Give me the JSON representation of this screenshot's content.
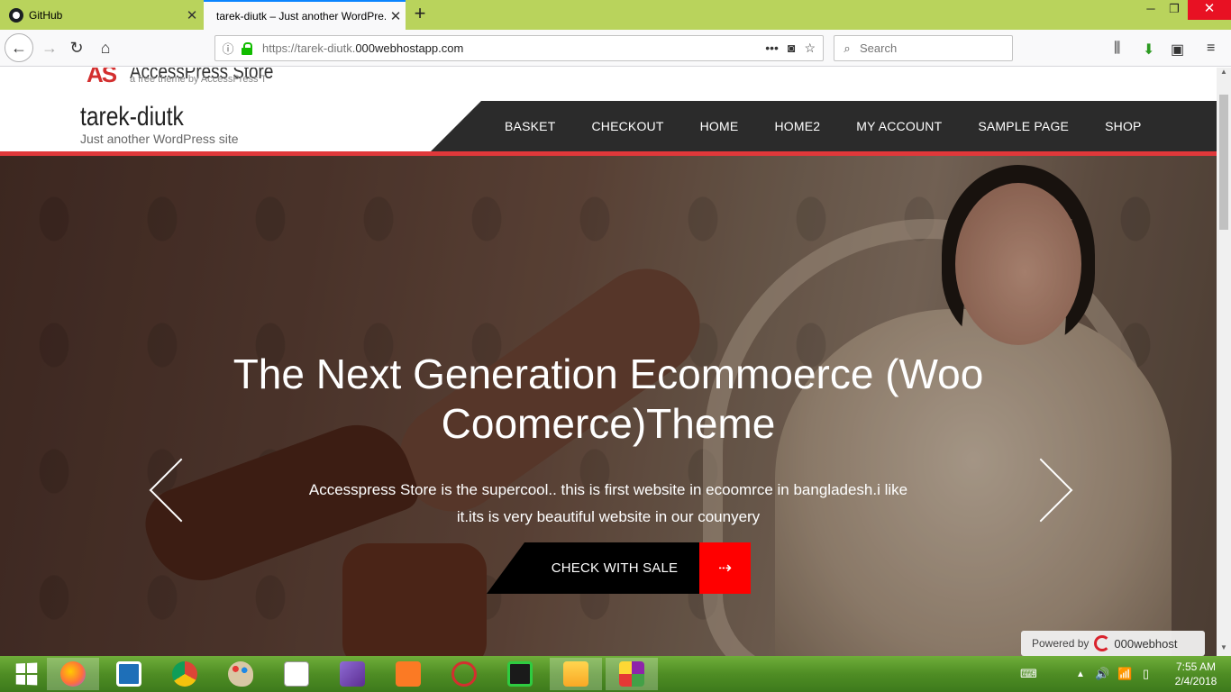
{
  "browser": {
    "tabs": [
      {
        "title": "GitHub",
        "icon": "github-icon"
      },
      {
        "title": "tarek-diutk – Just another WordPre..",
        "icon": "none"
      }
    ],
    "new_tab": "+",
    "window_controls": {
      "minimize": "─",
      "restore": "❐",
      "close": "✕"
    }
  },
  "navbar": {
    "url_scheme": "https://tarek-diutk.",
    "url_domain": "000webhostapp.com",
    "page_actions": "•••",
    "search_placeholder": "Search"
  },
  "site": {
    "logo_mark": "AS",
    "logo_name": "AccessPress Store",
    "logo_tagline": "a free theme by AccessPress T",
    "title": "tarek-diutk",
    "description": "Just another WordPress site",
    "menu": [
      "BASKET",
      "CHECKOUT",
      "HOME",
      "HOME2",
      "MY ACCOUNT",
      "SAMPLE PAGE",
      "SHOP"
    ]
  },
  "hero": {
    "title": "The Next Generation Ecommoerce (Woo Coomerce)Theme",
    "text": "Accesspress Store is the supercool.. this is first website in ecoomrce in bangladesh.i like it.its is very beautiful website in our counyery",
    "cta_label": "CHECK WITH SALE",
    "cta_arrow": "⇢"
  },
  "powered": {
    "label": "Powered by",
    "brand": "000webhost"
  },
  "taskbar": {
    "apps": [
      "windows-start",
      "firefox",
      "app-2",
      "chrome",
      "paint",
      "snipping-cursor",
      "visual-studio",
      "xampp",
      "snipping-tool",
      "emu8086",
      "file-explorer",
      "winrar"
    ],
    "clock_time": "7:55 AM",
    "clock_date": "2/4/2018"
  },
  "colors": {
    "tab_strip": "#b9d35c",
    "menu_bg": "#2b2b2b",
    "accent_red": "#e0383a",
    "cta_red": "#ff0000",
    "taskbar": "#4f8d24"
  }
}
